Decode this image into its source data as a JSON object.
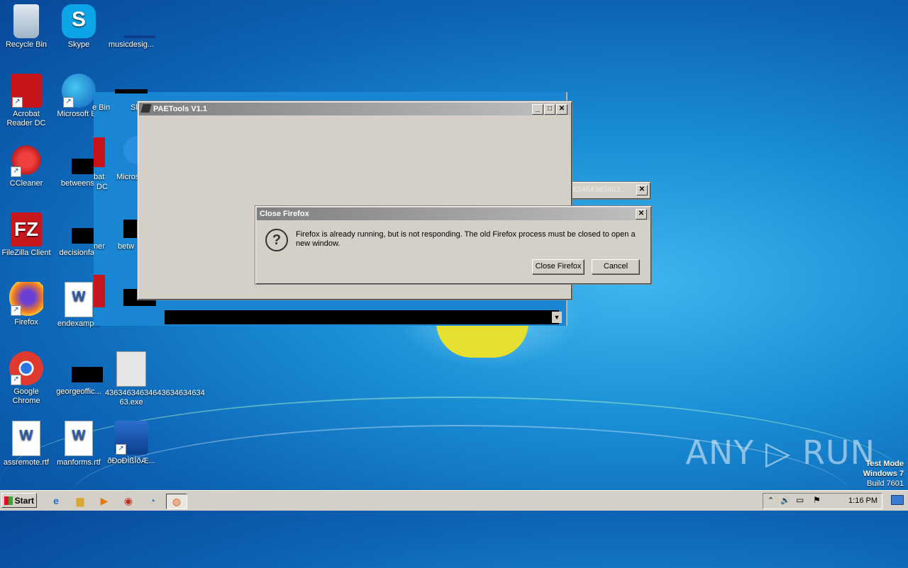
{
  "desktop": {
    "icons": [
      {
        "label": "Recycle Bin"
      },
      {
        "label": "Skype",
        "glyph": "S"
      },
      {
        "label": "musicdesig..."
      },
      {
        "label": "Acrobat Reader DC"
      },
      {
        "label": "Microsoft Ed"
      },
      {
        "label": "CCleaner"
      },
      {
        "label": "betweenst"
      },
      {
        "label": "FileZilla Client",
        "glyph": "FZ"
      },
      {
        "label": "decisionfav"
      },
      {
        "label": "Firefox"
      },
      {
        "label": "endexample"
      },
      {
        "label": "Google Chrome"
      },
      {
        "label": "georgeoffic..."
      },
      {
        "label": "43634634634643634634634 63.exe"
      },
      {
        "label": "assremote.rtf"
      },
      {
        "label": "manforms.rtf"
      },
      {
        "label": "ðÐoÐÌßÍðÆ..."
      }
    ],
    "ghost_labels": [
      "e Bin",
      "Sk",
      "bat",
      "DC",
      "Micros",
      "ner",
      "betw"
    ]
  },
  "paetools": {
    "title": "PAETools V1.1",
    "minimize": "_",
    "maximize": "□",
    "close": "✕"
  },
  "bg_window": {
    "title": "63464363463...",
    "close": "✕"
  },
  "dialog": {
    "title": "Close Firefox",
    "close": "✕",
    "icon": "?",
    "message": "Firefox is already running, but is not responding. The old Firefox process must be closed to open a new window.",
    "close_firefox_label": "Close Firefox",
    "cancel_label": "Cancel"
  },
  "taskbar": {
    "start_label": "Start",
    "pinned": [
      {
        "name": "ie-icon",
        "glyph": "e"
      },
      {
        "name": "explorer-icon",
        "glyph": "▆"
      },
      {
        "name": "media-player-icon",
        "glyph": "▶"
      },
      {
        "name": "chrome-icon",
        "glyph": "◉"
      },
      {
        "name": "edge-icon",
        "glyph": "◔"
      },
      {
        "name": "firefox-icon",
        "glyph": "◍"
      }
    ],
    "tray": {
      "chevron": "⌃",
      "volume": "🔊",
      "network": "▭",
      "flag": "⚑",
      "clock": "1:16 PM"
    }
  },
  "watermark": {
    "text": "ANY ▷ RUN"
  },
  "test_mode": {
    "line1": "Test Mode",
    "line2": "Windows 7",
    "line3": "Build 7601"
  }
}
